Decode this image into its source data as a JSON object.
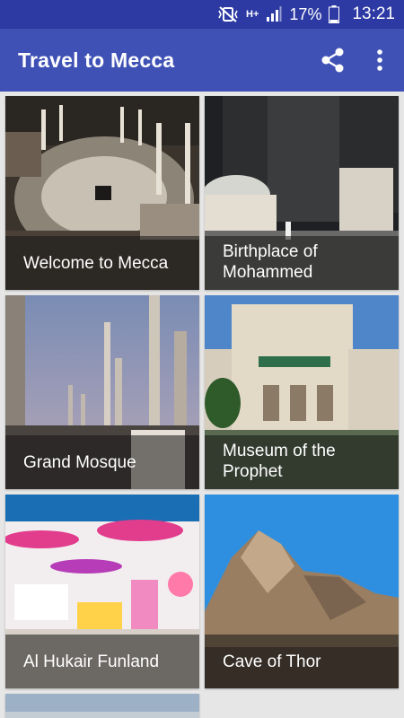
{
  "status_bar": {
    "battery": "17%",
    "time": "13:21",
    "network": "H+"
  },
  "app_bar": {
    "title": "Travel to Mecca",
    "share_icon": "share-icon",
    "more_icon": "more-vert-icon"
  },
  "places": [
    {
      "label_line1": "Welcome to Mecca",
      "label_line2": ""
    },
    {
      "label_line1": "Birthplace of",
      "label_line2": "Mohammed"
    },
    {
      "label_line1": "Grand Mosque",
      "label_line2": ""
    },
    {
      "label_line1": "Museum of the",
      "label_line2": "Prophet"
    },
    {
      "label_line1": "Al Hukair Funland",
      "label_line2": ""
    },
    {
      "label_line1": "Cave of Thor",
      "label_line2": ""
    }
  ],
  "colors": {
    "status_bar": "#2d3aa3",
    "app_bar": "#3f51b5",
    "grid_background": "#e6e6e6"
  }
}
